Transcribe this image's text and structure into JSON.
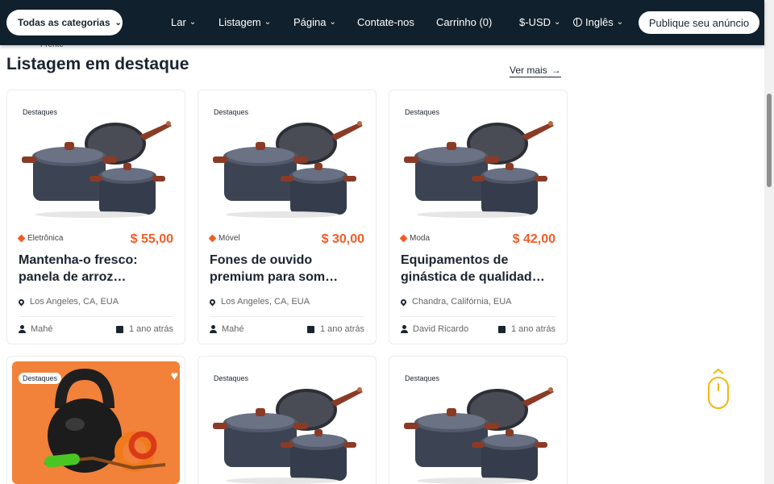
{
  "navbar": {
    "category_select": "Todas as categorias",
    "items": [
      {
        "label": "Lar",
        "has_dropdown": true
      },
      {
        "label": "Listagem",
        "has_dropdown": true
      },
      {
        "label": "Página",
        "has_dropdown": true
      },
      {
        "label": "Contate-nos",
        "has_dropdown": false
      },
      {
        "label": "Carrinho (0)",
        "has_dropdown": false
      }
    ],
    "currency": "$-USD",
    "language": "Inglês",
    "post_button": "Publique seu anúncio"
  },
  "partial_text": "Frente",
  "section": {
    "title": "Listagem em destaque",
    "see_more": "Ver mais"
  },
  "listings": [
    {
      "badge": "Destaques",
      "category": "Eletrônica",
      "price": "$ 55,00",
      "title": "Mantenha-o fresco: panela de arroz…",
      "location": "Los Angeles, CA, EUA",
      "author": "Mahé",
      "date": "1 ano atrás",
      "image": "cookware-set"
    },
    {
      "badge": "Destaques",
      "category": "Móvel",
      "price": "$ 30,00",
      "title": "Fones de ouvido premium para som…",
      "location": "Los Angeles, CA, EUA",
      "author": "Mahé",
      "date": "1 ano atrás",
      "image": "cookware-set"
    },
    {
      "badge": "Destaques",
      "category": "Moda",
      "price": "$ 42,00",
      "title": "Equipamentos de ginástica de qualidad…",
      "location": "Chandra, Califórnia, EUA",
      "author": "David Ricardo",
      "date": "1 ano atrás",
      "image": "cookware-set"
    },
    {
      "badge": "Destaques",
      "image": "kettlebell",
      "favorite": true
    },
    {
      "badge": "Destaques",
      "image": "cookware-set"
    },
    {
      "badge": "Destaques",
      "image": "cookware-set"
    }
  ],
  "colors": {
    "nav_bg": "#10202c",
    "accent": "#f25c26",
    "kettle_bg": "#f2813a",
    "scroll_hint": "#f1b70a"
  }
}
